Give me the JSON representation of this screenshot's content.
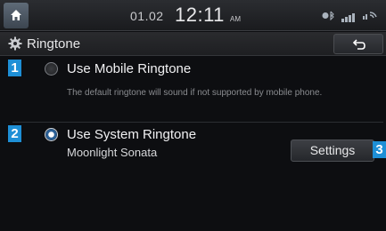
{
  "status_bar": {
    "date": "01.02",
    "time": "12:11",
    "ampm": "AM"
  },
  "header": {
    "title": "Ringtone"
  },
  "options": [
    {
      "number": "1",
      "label": "Use Mobile Ringtone",
      "description": "The default ringtone will sound if not supported by mobile phone.",
      "selected": false
    },
    {
      "number": "2",
      "label": "Use System Ringtone",
      "value": "Moonlight Sonata",
      "selected": true
    }
  ],
  "settings": {
    "number": "3",
    "label": "Settings"
  },
  "colors": {
    "accent": "#1e8fd6",
    "background": "#0d0e11"
  }
}
